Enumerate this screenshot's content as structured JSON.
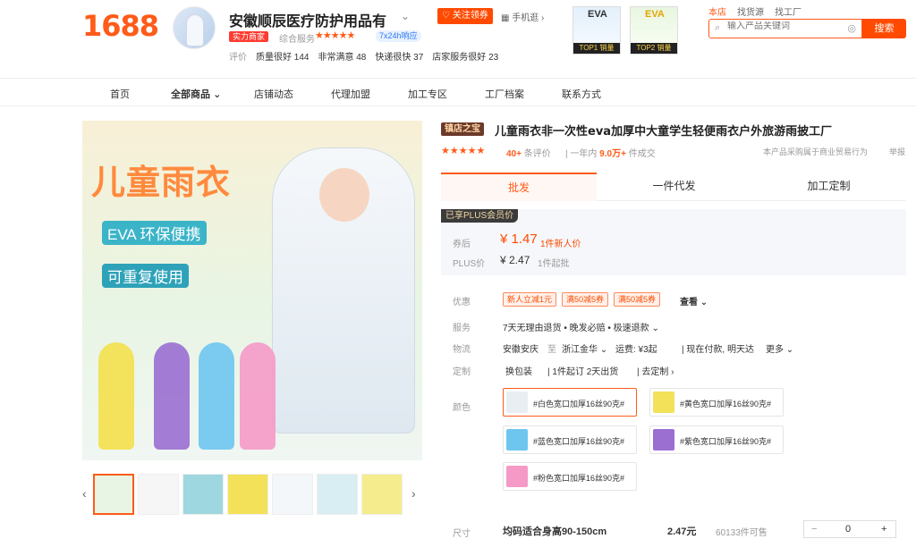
{
  "header": {
    "logo": "1688",
    "shop_name": "安徽顺辰医疗防护用品有",
    "follow_label": "关注领券",
    "phone_label": "手机逛",
    "real_factory": "实力商家",
    "service_label": "综合服务",
    "service_badge": "7x24h响应",
    "metrics": [
      {
        "label": "评价",
        "value": ""
      },
      {
        "label": "质量很好",
        "value": "144"
      },
      {
        "label": "非常满意",
        "value": "48"
      },
      {
        "label": "快递很快",
        "value": "37"
      },
      {
        "label": "店家服务很好",
        "value": "23"
      }
    ],
    "ads": [
      {
        "title": "EVA",
        "label": "TOP1 销量"
      },
      {
        "title": "EVA",
        "label": "TOP2 销量"
      }
    ],
    "top_links": [
      "本店",
      "找货源",
      "找工厂"
    ],
    "search_placeholder": "输入产品关键词",
    "search_button": "搜索"
  },
  "nav": [
    "首页",
    "全部商品",
    "店铺动态",
    "代理加盟",
    "加工专区",
    "工厂档案",
    "联系方式"
  ],
  "main_image": {
    "title": "儿童雨衣",
    "line1": "EVA 环保便携",
    "line2": "可重复使用"
  },
  "product": {
    "tag": "镇店之宝",
    "title": "儿童雨衣非一次性eva加厚中大童学生轻便雨衣户外旅游雨披工厂",
    "review_count": "40+",
    "review_suffix": "条评价",
    "sold_prefix": "一年内",
    "sold_value": "9.0万+",
    "sold_suffix": "件成交",
    "note": "本产品采购属于商业贸易行为",
    "report": "举报"
  },
  "tabs": [
    "批发",
    "一件代发",
    "加工定制"
  ],
  "price": {
    "plus_tag": "已享PLUS会员价",
    "coupon_label": "券后",
    "coupon_price": "¥ 1.47",
    "coupon_note": "1件新人价",
    "plus_label": "PLUS价",
    "plus_price": "¥ 2.47",
    "plus_note": "1件起批"
  },
  "offers": {
    "label": "优惠",
    "coupons": [
      "新人立减1元",
      "满50减5券",
      "满50减5券"
    ],
    "view": "查看"
  },
  "service": {
    "label": "服务",
    "value": "7天无理由退货 • 晚发必赔 • 极速退款"
  },
  "logistics": {
    "label": "物流",
    "from": "安徽安庆",
    "to_word": "至",
    "to": "浙江金华",
    "fee": "运费: ¥3起",
    "eta": "现在付款, 明天达",
    "more": "更多"
  },
  "custom": {
    "label": "定制",
    "items": [
      "换包装",
      "1件起订 2天出货"
    ],
    "link": "去定制"
  },
  "colors": {
    "label": "颜色",
    "options": [
      {
        "name": "#白色宽口加厚16丝90克#",
        "color": "#e9eef3",
        "selected": true
      },
      {
        "name": "#黄色宽口加厚16丝90克#",
        "color": "#f3e15a",
        "selected": false
      },
      {
        "name": "#蓝色宽口加厚16丝90克#",
        "color": "#6ec6ef",
        "selected": false
      },
      {
        "name": "#紫色宽口加厚16丝90克#",
        "color": "#9a6fd1",
        "selected": false
      },
      {
        "name": "#粉色宽口加厚16丝90克#",
        "color": "#f59ac6",
        "selected": false
      }
    ]
  },
  "size": {
    "label": "尺寸",
    "value": "均码适合身高90-150cm",
    "price": "2.47元",
    "stock": "60133件可售",
    "qty": "0"
  }
}
